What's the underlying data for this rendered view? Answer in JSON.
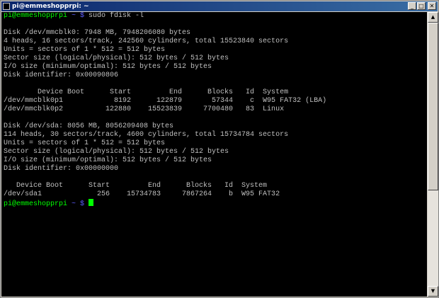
{
  "window": {
    "title": "pi@emmeshopprpi: ~",
    "buttons": {
      "minimize": "_",
      "maximize": "□",
      "close": "✕"
    }
  },
  "scrollbar": {
    "up_arrow": "▲",
    "down_arrow": "▼"
  },
  "colors": {
    "prompt": "#00ff00",
    "path": "#5c5cff",
    "text": "#c0c0c0",
    "background": "#000000"
  },
  "terminal": {
    "prompts": [
      {
        "user_host": "pi@emmeshopprpi",
        "path": " ~ $ ",
        "command": "sudo fdisk -l"
      },
      {
        "user_host": "pi@emmeshopprpi",
        "path": " ~ $ ",
        "command": ""
      }
    ],
    "output": [
      "",
      "Disk /dev/mmcblk0: 7948 MB, 7948206080 bytes",
      "4 heads, 16 sectors/track, 242560 cylinders, total 15523840 sectors",
      "Units = sectors of 1 * 512 = 512 bytes",
      "Sector size (logical/physical): 512 bytes / 512 bytes",
      "I/O size (minimum/optimal): 512 bytes / 512 bytes",
      "Disk identifier: 0x00090806",
      "",
      "        Device Boot      Start         End      Blocks   Id  System",
      "/dev/mmcblk0p1            8192      122879       57344    c  W95 FAT32 (LBA)",
      "/dev/mmcblk0p2          122880    15523839     7700480   83  Linux",
      "",
      "Disk /dev/sda: 8056 MB, 8056209408 bytes",
      "114 heads, 30 sectors/track, 4600 cylinders, total 15734784 sectors",
      "Units = sectors of 1 * 512 = 512 bytes",
      "Sector size (logical/physical): 512 bytes / 512 bytes",
      "I/O size (minimum/optimal): 512 bytes / 512 bytes",
      "Disk identifier: 0x00000000",
      "",
      "   Device Boot      Start         End      Blocks   Id  System",
      "/dev/sda1             256    15734783     7867264    b  W95 FAT32"
    ]
  }
}
